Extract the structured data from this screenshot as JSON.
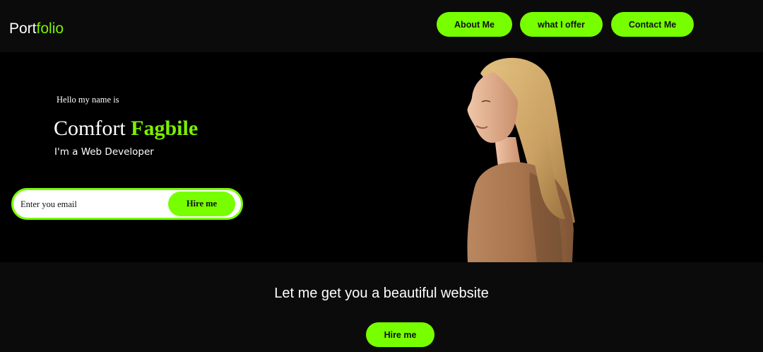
{
  "header": {
    "logo_part1": "Port",
    "logo_part2": "folio",
    "nav": {
      "about": "About Me",
      "offer": "what I offer",
      "contact": "Contact Me"
    }
  },
  "hero": {
    "intro": "Hello my name is",
    "first_name": "Comfort",
    "last_name": "Fagbile",
    "role": "I'm a Web Developer",
    "email_placeholder": "Enter you email",
    "hire_label": "Hire me"
  },
  "cta": {
    "text": "Let me get you a beautiful website",
    "button_label": "Hire me"
  },
  "colors": {
    "accent": "#77ff00",
    "background": "#0b0b0b",
    "hero_background": "#000000"
  }
}
